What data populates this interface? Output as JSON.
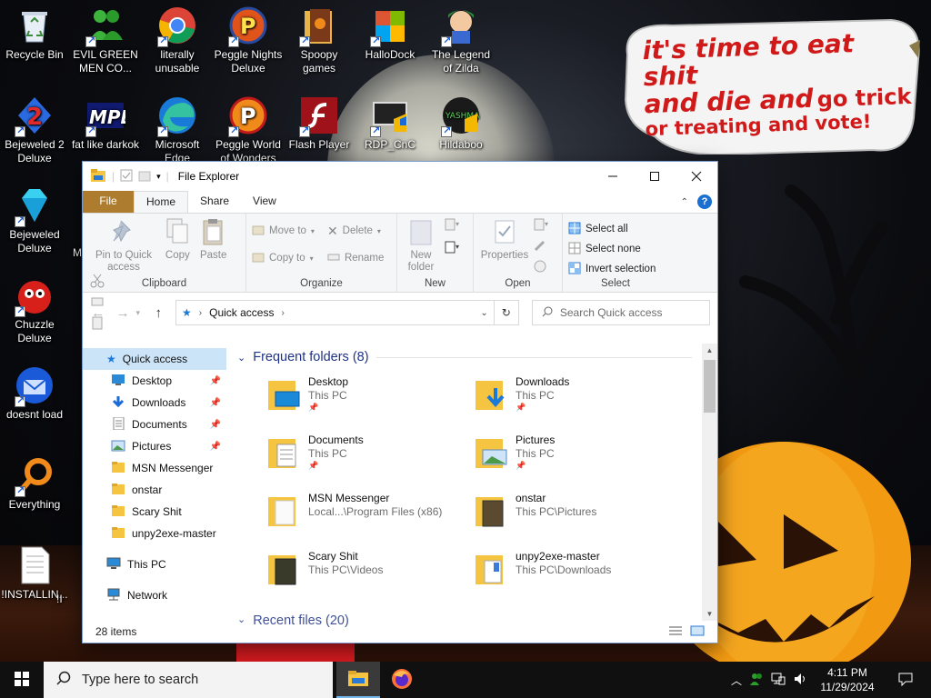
{
  "desktop": {
    "icons": [
      {
        "label": "Recycle Bin",
        "icon": "recycle-bin-icon"
      },
      {
        "label": "EVIL GREEN MEN CO...",
        "icon": "messenger-men-icon"
      },
      {
        "label": "literally unusable",
        "icon": "chrome-icon"
      },
      {
        "label": "Peggle Nights Deluxe",
        "icon": "peggle-nights-icon"
      },
      {
        "label": "Spoopy games",
        "icon": "spoopy-folder-icon"
      },
      {
        "label": "HalloDock",
        "icon": "windows-flag-icon"
      },
      {
        "label": "The Legend of Zilda",
        "icon": "zilda-game-icon"
      },
      {
        "label": "Bejeweled 2 Deluxe",
        "icon": "bejeweled2-icon"
      },
      {
        "label": "fat like darkok",
        "icon": "mpl-icon"
      },
      {
        "label": "Microsoft Edge",
        "icon": "edge-icon"
      },
      {
        "label": "Peggle World of Wonders",
        "icon": "peggle-world-icon"
      },
      {
        "label": "Flash Player",
        "icon": "flash-player-icon"
      },
      {
        "label": "RDP_CnC",
        "icon": "rdp-icon"
      },
      {
        "label": "Hildaboo",
        "icon": "hildaboo-icon"
      },
      {
        "label": "Bejeweled Deluxe",
        "icon": "bejeweled-icon"
      },
      {
        "label": "Chuzzle Deluxe",
        "icon": "chuzzle-icon"
      },
      {
        "label": "doesnt load",
        "icon": "thunderbird-icon"
      },
      {
        "label": "Everything",
        "icon": "everything-search-icon"
      },
      {
        "label": "!INSTALLIN...",
        "icon": "text-document-icon"
      },
      {
        "label": "!I",
        "icon": "partial-icon"
      },
      {
        "label": "M",
        "icon": "partial-icon"
      }
    ],
    "bubble": {
      "line1": "it's time to eat shit",
      "line2a": "and die and",
      "line2b": "go trick",
      "line3": "or treating and vote!"
    }
  },
  "explorer": {
    "title": "File Explorer",
    "tabs": {
      "file": "File",
      "home": "Home",
      "share": "Share",
      "view": "View"
    },
    "ribbon": {
      "clipboard": {
        "label": "Clipboard",
        "pin": "Pin to Quick access",
        "copy": "Copy",
        "paste": "Paste"
      },
      "organize": {
        "label": "Organize",
        "move_to": "Move to",
        "copy_to": "Copy to",
        "delete": "Delete",
        "rename": "Rename"
      },
      "new": {
        "label": "New",
        "new_folder": "New folder"
      },
      "open": {
        "label": "Open",
        "properties": "Properties"
      },
      "select": {
        "label": "Select",
        "select_all": "Select all",
        "select_none": "Select none",
        "invert": "Invert selection"
      }
    },
    "address": {
      "location": "Quick access",
      "search_placeholder": "Search Quick access"
    },
    "nav": {
      "quick_access": "Quick access",
      "items": [
        "Desktop",
        "Downloads",
        "Documents",
        "Pictures",
        "MSN Messenger",
        "onstar",
        "Scary Shit",
        "unpy2exe-master"
      ],
      "this_pc": "This PC",
      "network": "Network"
    },
    "frequent_header": "Frequent folders (8)",
    "folders": [
      {
        "name": "Desktop",
        "path": "This PC"
      },
      {
        "name": "Downloads",
        "path": "This PC"
      },
      {
        "name": "Documents",
        "path": "This PC"
      },
      {
        "name": "Pictures",
        "path": "This PC"
      },
      {
        "name": "MSN Messenger",
        "path": "Local...\\Program Files (x86)"
      },
      {
        "name": "onstar",
        "path": "This PC\\Pictures"
      },
      {
        "name": "Scary Shit",
        "path": "This PC\\Videos"
      },
      {
        "name": "unpy2exe-master",
        "path": "This PC\\Downloads"
      }
    ],
    "recent_header": "Recent files (20)",
    "status": "28 items"
  },
  "taskbar": {
    "search_placeholder": "Type here to search",
    "time": "4:11 PM",
    "date": "11/29/2024"
  },
  "colors": {
    "accent": "#0078d7",
    "file_tab": "#ad7c2e",
    "selected": "#cce4f7",
    "bubble_text": "#d01a1a"
  }
}
